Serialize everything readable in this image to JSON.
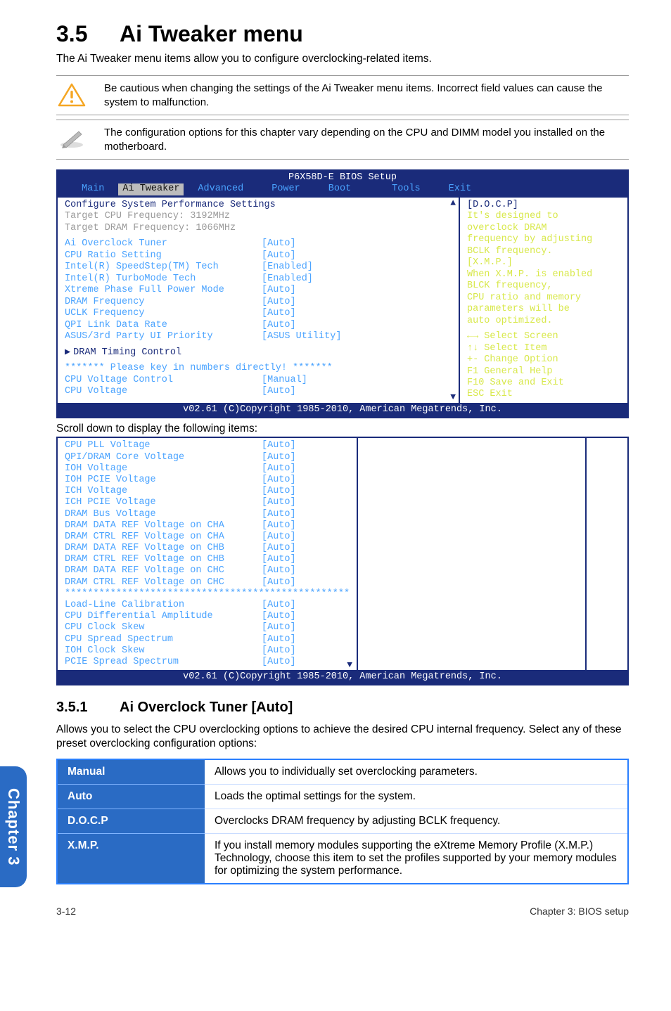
{
  "title_num": "3.5",
  "title_text": "Ai Tweaker menu",
  "lead": "The Ai Tweaker menu items allow you to configure overclocking-related items.",
  "note1": "Be cautious when changing the settings of the Ai Tweaker menu items. Incorrect field values can cause the system to malfunction.",
  "note2": "The configuration options for this chapter vary depending on the CPU and DIMM model you installed on the motherboard.",
  "bios": {
    "top": "P6X58D-E BIOS Setup",
    "menu": [
      "Main",
      "Ai Tweaker",
      "Advanced",
      "Power",
      "Boot",
      "Tools",
      "Exit"
    ],
    "left_header": "Configure System Performance Settings",
    "targets": [
      "Target CPU Frequency: 3192MHz",
      "Target DRAM Frequency: 1066MHz"
    ],
    "items": [
      {
        "lab": "Ai Overclock Tuner",
        "val": "[Auto]"
      },
      {
        "lab": "CPU Ratio Setting",
        "val": "[Auto]"
      },
      {
        "lab": "Intel(R) SpeedStep(TM) Tech",
        "val": "[Enabled]"
      },
      {
        "lab": "Intel(R) TurboMode Tech",
        "val": "[Enabled]"
      },
      {
        "lab": "Xtreme Phase Full Power Mode",
        "val": "[Auto]"
      },
      {
        "lab": "DRAM Frequency",
        "val": "[Auto]"
      },
      {
        "lab": "UCLK Frequency",
        "val": "[Auto]"
      },
      {
        "lab": "QPI Link Data Rate",
        "val": "[Auto]"
      },
      {
        "lab": "ASUS/3rd Party UI Priority",
        "val": "[ASUS Utility]"
      }
    ],
    "sub": "DRAM Timing Control",
    "stars": "******* Please key in numbers directly! *******",
    "tail": [
      {
        "lab": "CPU Voltage Control",
        "val": "[Manual]"
      },
      {
        "lab": "CPU Voltage",
        "val": "[Auto]"
      }
    ],
    "right_hdr": "[D.O.C.P]",
    "right_para_lines": [
      "It's designed to",
      "overclock DRAM",
      "frequency by adjusting",
      "BCLK frequency.",
      "[X.M.P.]",
      "When X.M.P. is enabled",
      "BLCK frequency,",
      "CPU ratio and memory",
      "parameters will be",
      "auto optimized."
    ],
    "right_keys": [
      "←→   Select Screen",
      "↑↓   Select Item",
      "+-   Change Option",
      "F1   General Help",
      "F10  Save and Exit",
      "ESC  Exit"
    ],
    "foot": "v02.61 (C)Copyright 1985-2010, American Megatrends, Inc."
  },
  "scroll_caption": "Scroll down to display the following items:",
  "bios2": {
    "items1": [
      {
        "lab": "CPU PLL Voltage",
        "val": "[Auto]"
      },
      {
        "lab": "QPI/DRAM Core Voltage",
        "val": "[Auto]"
      },
      {
        "lab": "IOH Voltage",
        "val": "[Auto]"
      },
      {
        "lab": "IOH PCIE Voltage",
        "val": "[Auto]"
      },
      {
        "lab": "ICH Voltage",
        "val": "[Auto]"
      },
      {
        "lab": "ICH PCIE Voltage",
        "val": "[Auto]"
      },
      {
        "lab": "DRAM Bus Voltage",
        "val": "[Auto]"
      },
      {
        "lab": "DRAM DATA REF Voltage on CHA",
        "val": "[Auto]"
      },
      {
        "lab": "DRAM CTRL REF Voltage on CHA",
        "val": "[Auto]"
      },
      {
        "lab": "DRAM DATA REF Voltage on CHB",
        "val": "[Auto]"
      },
      {
        "lab": "DRAM CTRL REF Voltage on CHB",
        "val": "[Auto]"
      },
      {
        "lab": "DRAM DATA REF Voltage on CHC",
        "val": "[Auto]"
      },
      {
        "lab": "DRAM CTRL REF Voltage on CHC",
        "val": "[Auto]"
      }
    ],
    "stars": "**************************************************",
    "items2": [
      {
        "lab": "Load-Line Calibration",
        "val": "[Auto]"
      },
      {
        "lab": "CPU Differential Amplitude",
        "val": "[Auto]"
      },
      {
        "lab": "CPU Clock Skew",
        "val": "[Auto]"
      },
      {
        "lab": "CPU Spread Spectrum",
        "val": "[Auto]"
      },
      {
        "lab": "IOH Clock Skew",
        "val": "[Auto]"
      },
      {
        "lab": "PCIE Spread Spectrum",
        "val": "[Auto]"
      }
    ],
    "foot": "v02.61 (C)Copyright 1985-2010, American Megatrends, Inc."
  },
  "sub_num": "3.5.1",
  "sub_text": "Ai Overclock Tuner [Auto]",
  "sub_body": "Allows you to select the CPU overclocking options to achieve the desired CPU internal frequency. Select any of these preset overclocking configuration options:",
  "opts": [
    {
      "k": "Manual",
      "v": "Allows you to individually set overclocking parameters."
    },
    {
      "k": "Auto",
      "v": "Loads the optimal settings for the system."
    },
    {
      "k": "D.O.C.P",
      "v": "Overclocks DRAM frequency by adjusting BCLK frequency."
    },
    {
      "k": "X.M.P.",
      "v": "If you install memory modules supporting the eXtreme Memory Profile (X.M.P.) Technology, choose this item to set the profiles supported by your memory modules for optimizing the system performance."
    }
  ],
  "side_tab": "Chapter 3",
  "footer_left": "3-12",
  "footer_right": "Chapter 3: BIOS setup"
}
